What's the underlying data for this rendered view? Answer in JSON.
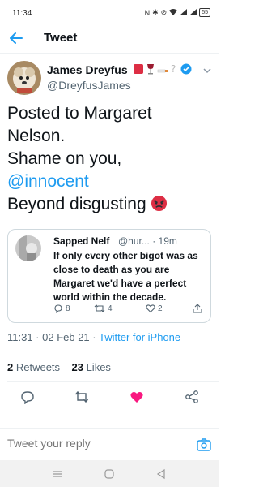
{
  "status_bar": {
    "time": "11:34",
    "icons": [
      "nfc-icon",
      "bluetooth-icon",
      "mute-icon",
      "wifi-icon",
      "signal-icon",
      "signal-icon",
      "battery-icon"
    ],
    "battery_level": "55"
  },
  "header": {
    "title": "Tweet",
    "back_icon": "back-arrow-icon"
  },
  "tweet": {
    "author": {
      "name": "James Dreyfus",
      "handle": "@DreyfusJames",
      "name_emojis": [
        "red-square-emoji",
        "wine-glass-emoji",
        "cigarette-emoji",
        "question-mark-emoji"
      ],
      "verified": true
    },
    "text_lines": [
      "Posted to Margaret",
      "Nelson.",
      "Shame on you,"
    ],
    "mention": "@innocent",
    "text_last": "Beyond disgusting",
    "quoted": {
      "name": "Sapped Nelf",
      "handle": "@hur...",
      "time": "· 19m",
      "text": "If only every other bigot was as close to death as you are Margaret we'd have a perfect world within the decade.",
      "replies": "8",
      "retweets": "4",
      "likes": "2"
    },
    "timestamp": "11:31 · 02 Feb 21 · ",
    "source": "Twitter for iPhone",
    "retweet_count": "2",
    "retweet_label": " Retweets",
    "like_count": "23",
    "like_label": " Likes"
  },
  "reply_bar": {
    "placeholder": "Tweet your reply"
  },
  "colors": {
    "accent": "#1d9bf0",
    "like_active": "#f91880",
    "text_primary": "#0f1419",
    "text_secondary": "#536471"
  }
}
